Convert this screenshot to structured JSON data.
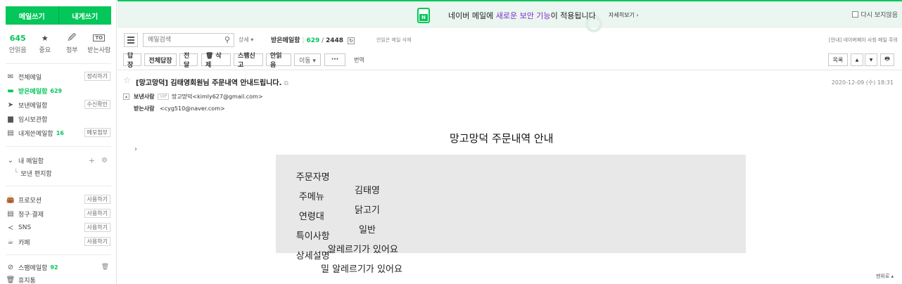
{
  "sidebar": {
    "write_button": "메일쓰기",
    "self_write_button": "내게쓰기",
    "stats": [
      {
        "value": "645",
        "label": "안읽음"
      },
      {
        "value": "★",
        "label": "중요"
      },
      {
        "value": "🖉",
        "label": "첨부"
      },
      {
        "value": "TO",
        "label": "받는사람"
      }
    ],
    "folders": [
      {
        "label": "전체메일",
        "count": "",
        "tag": "정리하기",
        "icon": "mail-icon"
      },
      {
        "label": "받은메일함",
        "count": "629",
        "tag": "",
        "icon": "inbox-icon"
      },
      {
        "label": "보낸메일함",
        "count": "",
        "tag": "수신확인",
        "icon": "send-icon"
      },
      {
        "label": "임시보관함",
        "count": "",
        "tag": "",
        "icon": "folder-icon"
      },
      {
        "label": "내게쓴메일함",
        "count": "16",
        "tag": "메모첨부",
        "icon": "note-icon"
      }
    ],
    "my_mailbox": {
      "label": "내 메일함",
      "add": "+",
      "settings": "⚙",
      "sub": "보낸 편지함"
    },
    "services": [
      {
        "label": "프로모션",
        "tag": "사용하기",
        "icon": "bag-icon"
      },
      {
        "label": "청구·결제",
        "tag": "사용하기",
        "icon": "receipt-icon"
      },
      {
        "label": "SNS",
        "tag": "사용하기",
        "icon": "share-icon"
      },
      {
        "label": "카페",
        "tag": "사용하기",
        "icon": "cafe-icon"
      }
    ],
    "spam": {
      "label": "스팸메일함",
      "count": "92",
      "action": "🗑"
    },
    "trash": {
      "label": "휴지통"
    }
  },
  "banner": {
    "text_before": "네이버 메일에 ",
    "highlight": "새로운 보안 기능",
    "text_after": "이 적용됩니다",
    "more_link": "자세히보기 ›",
    "dismiss": "다시 보지않음",
    "badge": "N"
  },
  "toolbar": {
    "search_placeholder": "메일검색",
    "detail": "상세 ▾",
    "folder_name": "받은메일함",
    "unread": "629",
    "total": "2448",
    "delete_unread": "안읽은 메일 삭제",
    "notice": "[안내] 네이버페이 사칭 메일 주의",
    "buttons": {
      "reply": "답장",
      "reply_all": "전체답장",
      "forward": "전달",
      "delete": "🗑 삭제",
      "spam": "스팸신고",
      "unread": "안읽음",
      "move": "이동 ▾",
      "more": "···",
      "translate": "번역"
    },
    "list_button": "목록",
    "up": "▲",
    "down": "▼",
    "print": "🖶"
  },
  "mail": {
    "subject": "[망고망덕] 김태영회원님 주문내역 안내드립니다.",
    "date": "2020-12-09 (수) 18:31",
    "from_label": "보낸사람",
    "vip": "VIP",
    "from": "망고망덕<kimly627@gmail.com>",
    "to_label": "받는사람",
    "to": "<cyg510@naver.com>",
    "body_title": "망고망덕 주문내역 안내",
    "rows": [
      {
        "label": "주문자명",
        "value": "김태영"
      },
      {
        "label": " 주메뉴",
        "value": "닭고기"
      },
      {
        "label": " 연령대",
        "value": "일반"
      },
      {
        "label": "특이사항",
        "value": "알레르기가 있어요"
      },
      {
        "label": "상세설명",
        "value": "밀 알레르기가 있어요"
      }
    ],
    "top_link": "맨위로 ▴"
  },
  "colors": {
    "accent": "#03c75a",
    "highlight": "#7a2fd0"
  }
}
